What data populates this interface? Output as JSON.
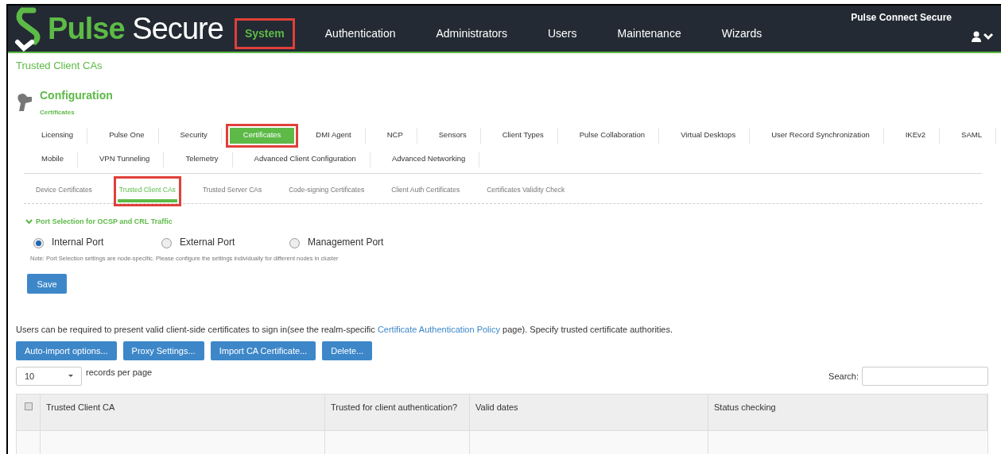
{
  "header": {
    "logo": {
      "brand_a": "Pulse",
      "brand_b": "Secure"
    },
    "product": "Pulse Connect Secure",
    "nav": [
      {
        "label": "System",
        "selected": true,
        "annotated": true
      },
      {
        "label": "Authentication",
        "selected": false,
        "annotated": false
      },
      {
        "label": "Administrators",
        "selected": false,
        "annotated": false
      },
      {
        "label": "Users",
        "selected": false,
        "annotated": false
      },
      {
        "label": "Maintenance",
        "selected": false,
        "annotated": false
      },
      {
        "label": "Wizards",
        "selected": false,
        "annotated": false
      }
    ]
  },
  "breadcrumb": "Trusted Client CAs",
  "section": {
    "title": "Configuration",
    "subtitle": "Certificates"
  },
  "tab_rows": [
    [
      {
        "label": "Licensing",
        "selected": false,
        "annotated": false
      },
      {
        "label": "Pulse One",
        "selected": false,
        "annotated": false
      },
      {
        "label": "Security",
        "selected": false,
        "annotated": false
      },
      {
        "label": "Certificates",
        "selected": true,
        "annotated": true
      },
      {
        "label": "DMI Agent",
        "selected": false,
        "annotated": false
      },
      {
        "label": "NCP",
        "selected": false,
        "annotated": false
      },
      {
        "label": "Sensors",
        "selected": false,
        "annotated": false
      },
      {
        "label": "Client Types",
        "selected": false,
        "annotated": false
      },
      {
        "label": "Pulse Collaboration",
        "selected": false,
        "annotated": false
      },
      {
        "label": "Virtual Desktops",
        "selected": false,
        "annotated": false
      },
      {
        "label": "User Record Synchronization",
        "selected": false,
        "annotated": false
      },
      {
        "label": "IKEv2",
        "selected": false,
        "annotated": false
      },
      {
        "label": "SAML",
        "selected": false,
        "annotated": false
      }
    ],
    [
      {
        "label": "Mobile",
        "selected": false,
        "annotated": false
      },
      {
        "label": "VPN Tunneling",
        "selected": false,
        "annotated": false
      },
      {
        "label": "Telemetry",
        "selected": false,
        "annotated": false
      },
      {
        "label": "Advanced Client Configuration",
        "selected": false,
        "annotated": false
      },
      {
        "label": "Advanced Networking",
        "selected": false,
        "annotated": false
      }
    ]
  ],
  "subtabs": [
    {
      "label": "Device Certificates",
      "selected": false,
      "annotated": false
    },
    {
      "label": "Trusted Client CAs",
      "selected": true,
      "annotated": true
    },
    {
      "label": "Trusted Server CAs",
      "selected": false,
      "annotated": false
    },
    {
      "label": "Code-signing Certificates",
      "selected": false,
      "annotated": false
    },
    {
      "label": "Client Auth Certificates",
      "selected": false,
      "annotated": false
    },
    {
      "label": "Certificates Validity Check",
      "selected": false,
      "annotated": false
    }
  ],
  "port_section": {
    "title": "Port Selection for OCSP and CRL Traffic",
    "expanded": true,
    "options": [
      {
        "label": "Internal Port",
        "selected": true
      },
      {
        "label": "External Port",
        "selected": false
      },
      {
        "label": "Management Port",
        "selected": false
      }
    ],
    "note": "Note: Port Selection settings are node-specific. Please configure the settings individually for different nodes in cluster",
    "save": "Save"
  },
  "description": {
    "before": "Users can be required to present valid client-side certificates to sign in(see the realm-specific",
    "link": "Certificate Authentication Policy",
    "after": "page). Specify trusted certificate authorities."
  },
  "actions": [
    "Auto-import options...",
    "Proxy Settings...",
    "Import CA Certificate...",
    "Delete..."
  ],
  "page_size": {
    "value": "10",
    "label": "records per page"
  },
  "search": {
    "label": "Search:"
  },
  "table": {
    "select_all": false,
    "columns": [
      "Trusted Client CA",
      "Trusted for client authentication?",
      "Valid dates",
      "Status checking"
    ]
  }
}
